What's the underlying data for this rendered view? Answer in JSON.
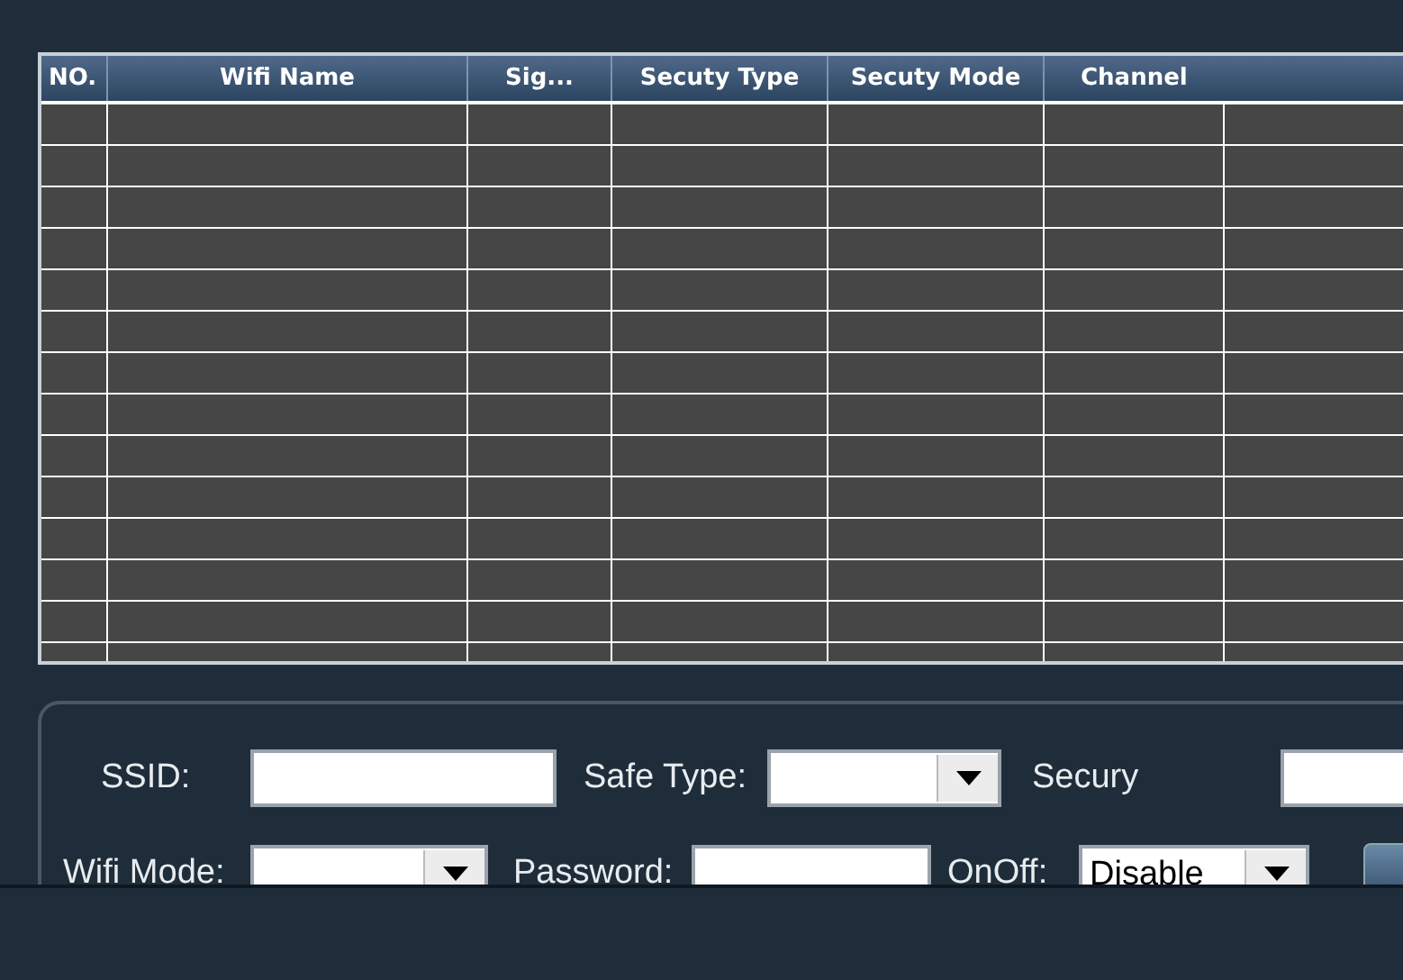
{
  "table": {
    "columns": [
      "NO.",
      "Wifi Name",
      "Sig...",
      "Secuty Type",
      "Secuty Mode",
      "Channel"
    ]
  },
  "form": {
    "rows": [
      [
        {
          "label": "SSID:",
          "kind": "input"
        },
        {
          "label": "Safe Type:",
          "kind": "select"
        },
        {
          "label": "Secury",
          "kind": "input"
        }
      ],
      [
        {
          "label": "Wifi Mode:",
          "kind": "select"
        },
        {
          "label": "Password:",
          "kind": "input"
        },
        {
          "label": "OnOff:",
          "kind": "select",
          "value": "Disable"
        },
        {
          "kind": "button"
        }
      ]
    ]
  }
}
